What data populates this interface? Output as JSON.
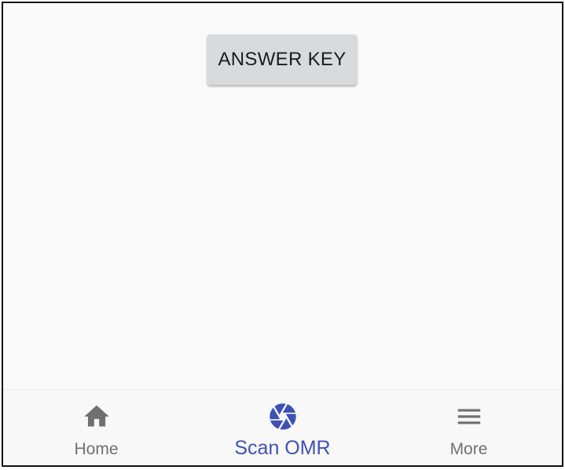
{
  "main": {
    "answer_key_label": "ANSWER KEY"
  },
  "bottom_nav": {
    "items": [
      {
        "label": "Home",
        "icon": "home-icon",
        "color": "#707070",
        "active": false
      },
      {
        "label": "Scan OMR",
        "icon": "camera-aperture-icon",
        "color": "#3f51b5",
        "active": true
      },
      {
        "label": "More",
        "icon": "menu-icon",
        "color": "#707070",
        "active": false
      }
    ]
  },
  "colors": {
    "accent": "#3f51b5",
    "inactive": "#707070",
    "button_bg": "#d9dadb",
    "background": "#fafafa"
  }
}
